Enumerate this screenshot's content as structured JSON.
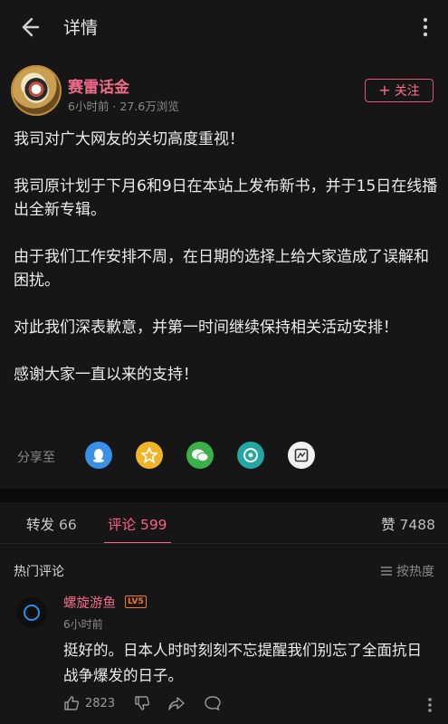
{
  "header": {
    "title": "详情",
    "back_icon": "arrow-left-icon",
    "more_icon": "more-vertical-icon"
  },
  "post": {
    "author": "赛雷话金",
    "meta": "6小时前 · 27.6万浏览",
    "follow_label": "关注",
    "paragraphs": [
      "我司对广大网友的关切高度重视！",
      "我司原计划于下月6和9日在本站上发布新书，并于15日在线播出全新专辑。",
      "由于我们工作安排不周，在日期的选择上给大家造成了误解和困扰。",
      "对此我们深表歉意，并第一时间继续保持相关活动安排！",
      "感谢大家一直以来的支持！"
    ]
  },
  "share": {
    "label": "分享至",
    "targets": [
      {
        "name": "qq",
        "color": "#3a8fe6"
      },
      {
        "name": "qzone",
        "color": "#f0b429"
      },
      {
        "name": "wechat",
        "color": "#3bb04a"
      },
      {
        "name": "moments",
        "color": "#22a8a0"
      },
      {
        "name": "weibo",
        "color": "#f2f2f2"
      }
    ]
  },
  "tabs": {
    "repost_label": "转发",
    "repost_count": "66",
    "comment_label": "评论",
    "comment_count": "599",
    "like_label": "赞",
    "like_count": "7488"
  },
  "comments": {
    "section_label": "热门评论",
    "sort_label": "按热度",
    "items": [
      {
        "name": "螺旋游鱼",
        "level": "LV5",
        "time": "6小时前",
        "text": "挺好的。日本人时时刻刻不忘提醒我们别忘了全面抗日战争爆发的日子。",
        "likes": "2823"
      }
    ]
  },
  "colors": {
    "accent": "#ff5f87",
    "background": "#161616"
  }
}
